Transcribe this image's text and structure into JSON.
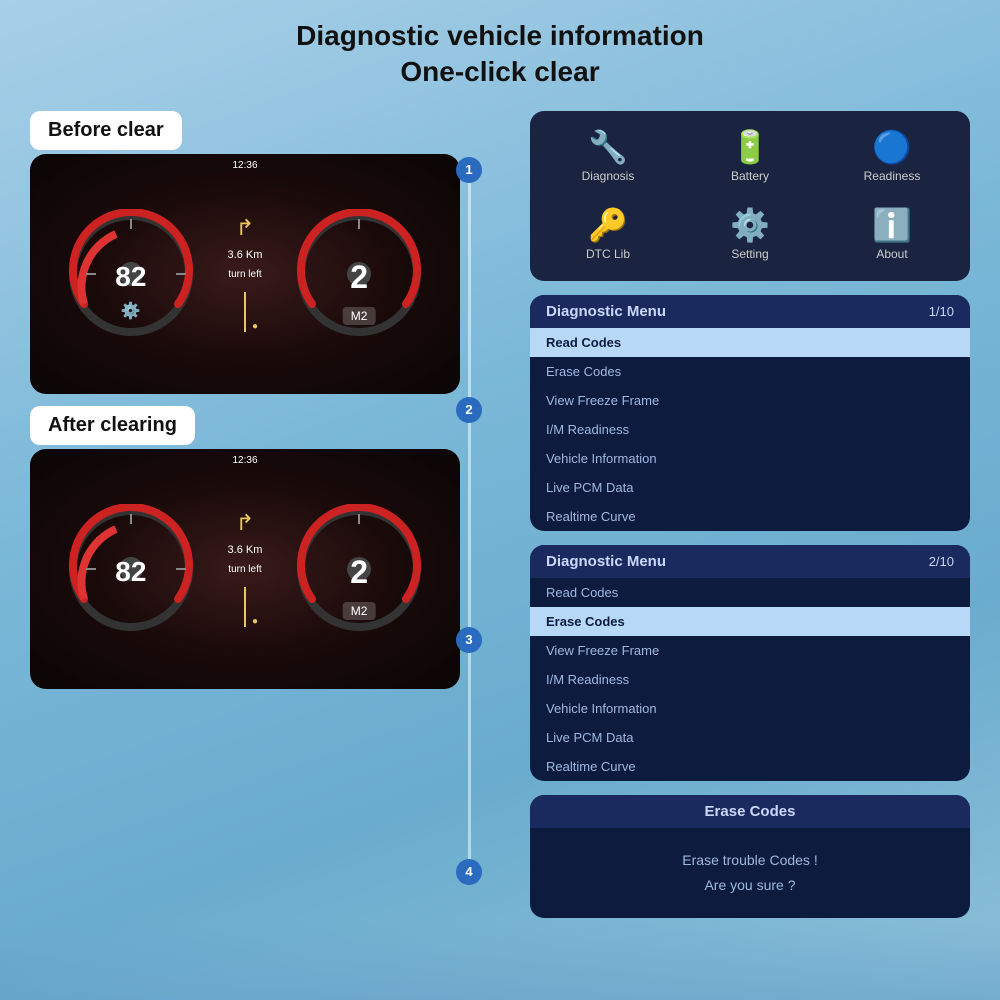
{
  "title": {
    "line1": "Diagnostic vehicle information",
    "line2": "One-click clear"
  },
  "left": {
    "before_label": "Before clear",
    "after_label": "After clearing",
    "dashboard_time": "12:36",
    "speed_value": "82",
    "rpm_value": "2",
    "nav_distance": "3.6 Km",
    "nav_direction": "turn left",
    "m2_label": "M2",
    "warning_icon": "⚙"
  },
  "icon_grid": {
    "items": [
      {
        "emoji": "🔧",
        "label": "Diagnosis"
      },
      {
        "emoji": "🔋",
        "label": "Battery"
      },
      {
        "emoji": "🔵",
        "label": "Readiness"
      },
      {
        "emoji": "🔑",
        "label": "DTC Lib"
      },
      {
        "emoji": "⚙️",
        "label": "Setting"
      },
      {
        "emoji": "ℹ️",
        "label": "About"
      }
    ]
  },
  "diag_menu_1": {
    "title": "Diagnostic Menu",
    "page": "1/10",
    "items": [
      {
        "label": "Read Codes",
        "active": true
      },
      {
        "label": "Erase Codes",
        "active": false
      },
      {
        "label": "View Freeze Frame",
        "active": false
      },
      {
        "label": "I/M Readiness",
        "active": false
      },
      {
        "label": "Vehicle Information",
        "active": false
      },
      {
        "label": "Live PCM Data",
        "active": false
      },
      {
        "label": "Realtime Curve",
        "active": false
      }
    ]
  },
  "diag_menu_2": {
    "title": "Diagnostic Menu",
    "page": "2/10",
    "items": [
      {
        "label": "Read Codes",
        "active": false
      },
      {
        "label": "Erase Codes",
        "active": true
      },
      {
        "label": "View Freeze Frame",
        "active": false
      },
      {
        "label": "I/M Readiness",
        "active": false
      },
      {
        "label": "Vehicle Information",
        "active": false
      },
      {
        "label": "Live PCM Data",
        "active": false
      },
      {
        "label": "Realtime Curve",
        "active": false
      }
    ]
  },
  "erase_panel": {
    "title": "Erase Codes",
    "line1": "Erase trouble Codes !",
    "line2": "Are you sure ?"
  },
  "steps": [
    "1",
    "2",
    "3",
    "4"
  ]
}
